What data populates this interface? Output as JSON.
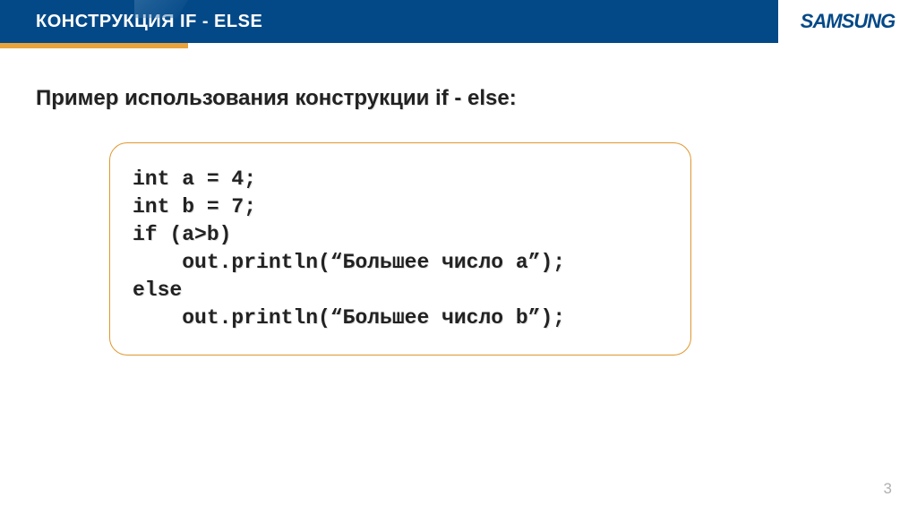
{
  "header": {
    "title": "КОНСТРУКЦИЯ IF - ELSE",
    "logo": "SAMSUNG"
  },
  "subtitle": "Пример использования конструкции if - else:",
  "code": {
    "line1": "int a = 4;",
    "line2": "int b = 7;",
    "line3": "if (a>b)",
    "line4": "    out.println(“Большее число a”);",
    "line5": "else",
    "line6": "    out.println(“Большее число b”);"
  },
  "page_number": "3"
}
